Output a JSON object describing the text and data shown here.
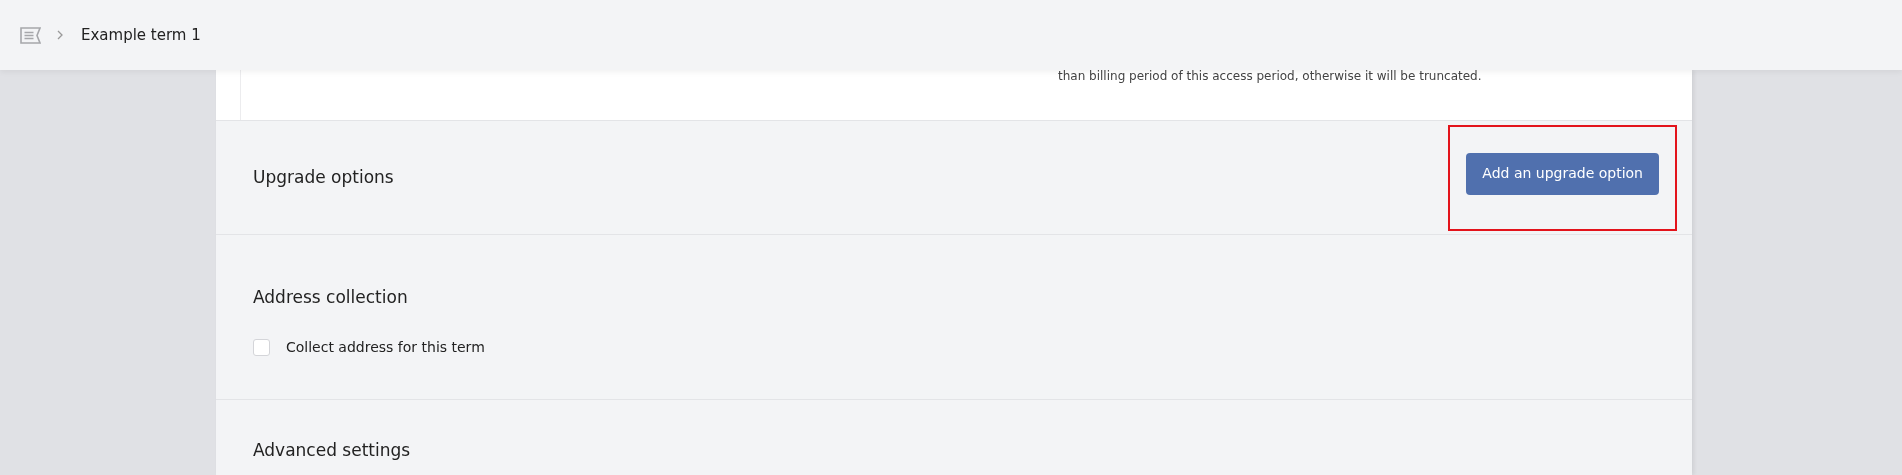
{
  "header": {
    "breadcrumb": "Example term 1"
  },
  "note": "than billing period of this access period, otherwise it will be truncated.",
  "sections": [
    {
      "kind": "button",
      "title": "Upgrade options",
      "button": {
        "label": "Add an upgrade option",
        "highlighted": true
      }
    },
    {
      "kind": "checkbox",
      "title": "Address collection",
      "checkbox": {
        "label": "Collect address for this term",
        "checked": false
      }
    },
    {
      "kind": "plain",
      "title": "Advanced settings"
    }
  ]
}
